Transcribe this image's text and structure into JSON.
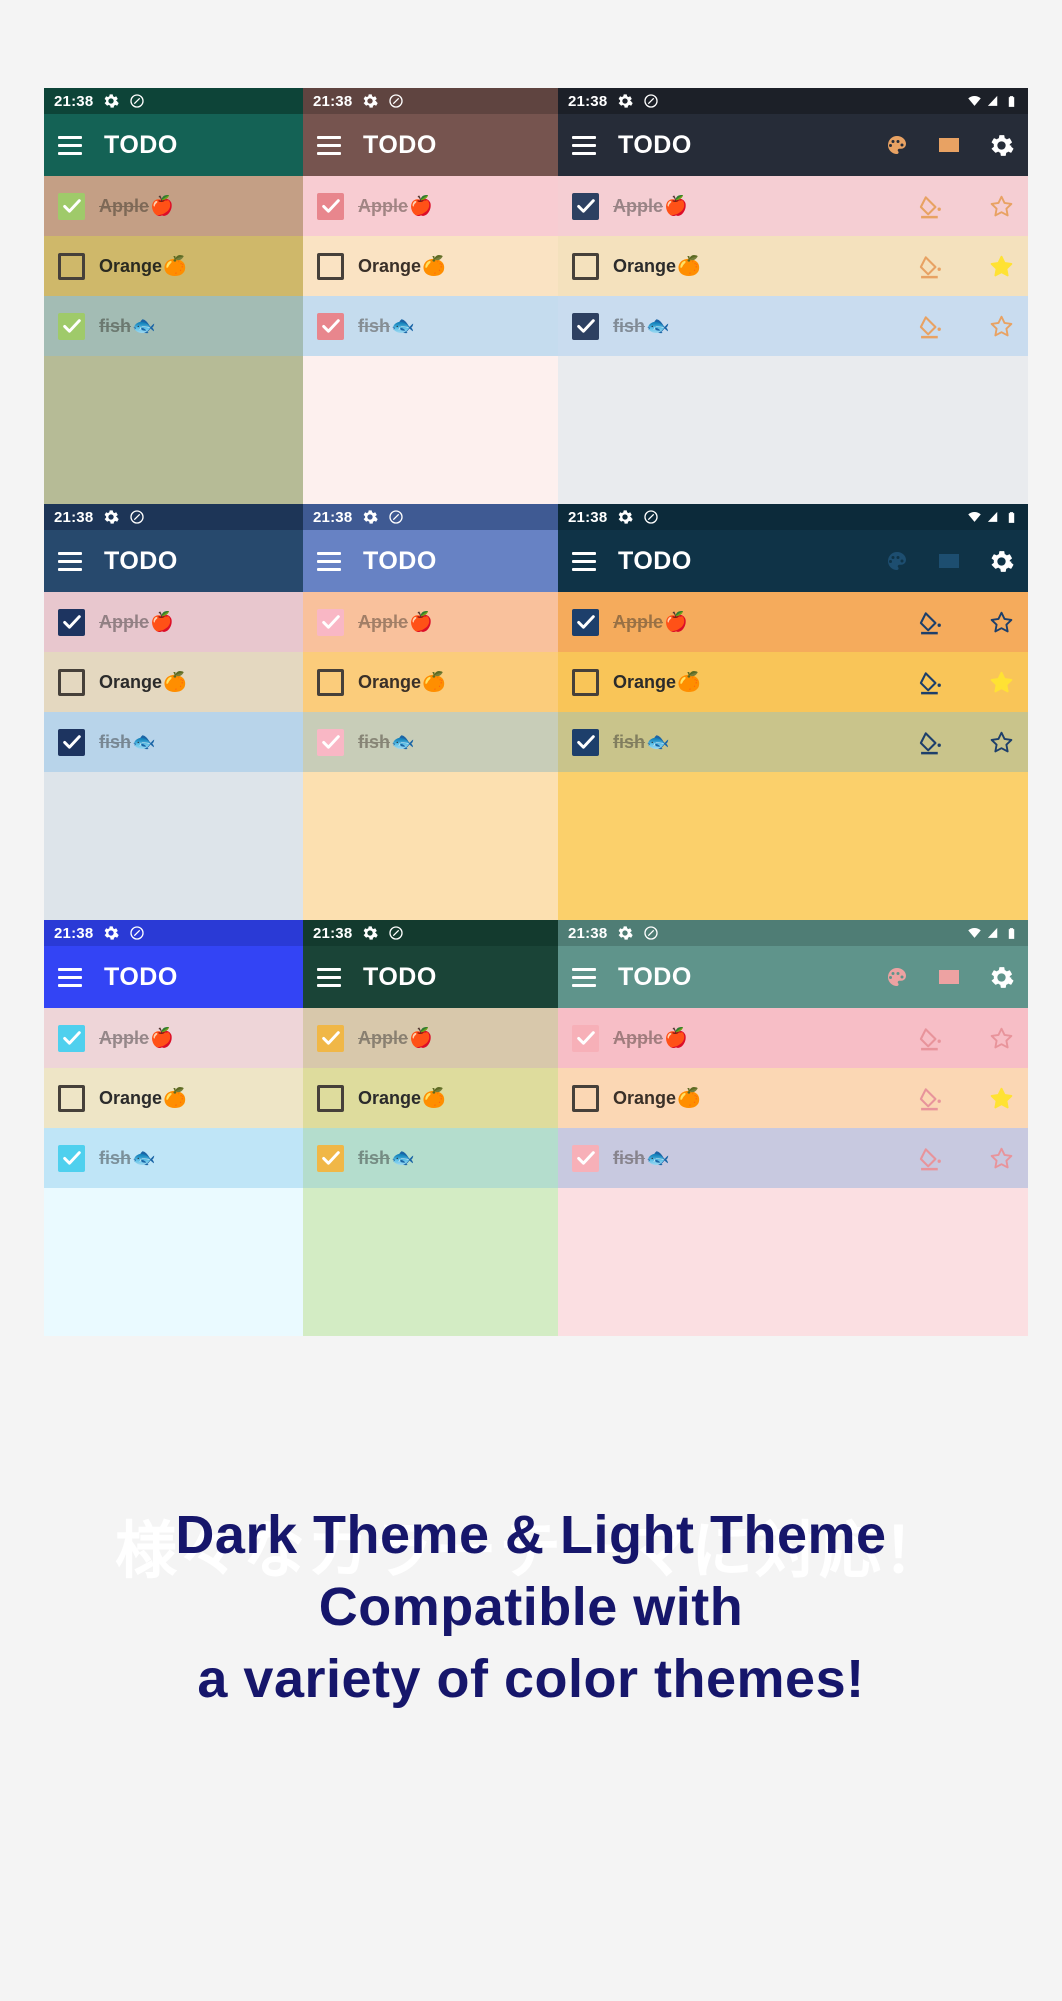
{
  "caption": {
    "jp_line": "様々なカラーテーマに対応！",
    "en_line1": "Dark Theme & Light Theme",
    "en_line2": "Compatible with",
    "en_line3": "a variety of color themes!",
    "en_color": "#16166b",
    "jp_color": "#ffffff"
  },
  "status_bar": {
    "time": "21:38",
    "icons": [
      "gear-icon",
      "do-not-disturb-icon"
    ],
    "right_icons": [
      "wifi-icon",
      "cell-signal-icon",
      "battery-icon"
    ]
  },
  "app": {
    "title": "TODO",
    "menu_icon": "hamburger-icon",
    "actions": [
      "palette-icon",
      "keyboard-icon",
      "settings-gear-icon"
    ],
    "row_actions": [
      "paint-bucket-icon",
      "star-icon"
    ]
  },
  "todos": [
    {
      "label": "Apple",
      "emoji": "🍎",
      "checked": true
    },
    {
      "label": "Orange",
      "emoji": "🍊",
      "checked": false
    },
    {
      "label": "fish",
      "emoji": "🐟",
      "checked": true
    }
  ],
  "themes": [
    {
      "id": "teal-dark",
      "name": "Dark Teal",
      "show_actions": false,
      "show_signal": false,
      "statusbar_bg": "#0d4438",
      "appbar_bg": "#146255",
      "appbar_fg": "#ffffff",
      "action_fg": "#ffffff",
      "body_bg": "#b6bb96",
      "row_bg": [
        "#c49f85",
        "#cfb86a",
        "#a3bcb4"
      ],
      "check_bg": "#9fca6a",
      "check_fg": "#ffffff",
      "text_fg": "#2a2a20",
      "row_action_fg": "#d98f4e"
    },
    {
      "id": "mauve",
      "name": "Mauve Brown",
      "show_actions": false,
      "show_signal": false,
      "statusbar_bg": "#5f4440",
      "appbar_bg": "#76544f",
      "appbar_fg": "#ffffff",
      "action_fg": "#ffffff",
      "body_bg": "#fdf0ee",
      "row_bg": [
        "#f8ccd2",
        "#fae3c3",
        "#c5dcee"
      ],
      "check_bg": "#e8868d",
      "check_fg": "#ffffff",
      "text_fg": "#3a3028",
      "row_action_fg": "#e8868d"
    },
    {
      "id": "charcoal",
      "name": "Charcoal Dark",
      "show_actions": true,
      "show_signal": true,
      "statusbar_bg": "#1c2028",
      "appbar_bg": "#262c38",
      "appbar_fg": "#ffffff",
      "action_fg": "#e8a263",
      "body_bg": "#e9ebee",
      "row_bg": [
        "#f5ced3",
        "#f4e1bd",
        "#c9dcef"
      ],
      "check_bg": "#2d4061",
      "check_fg": "#ffffff",
      "text_fg": "#2b2b2b",
      "row_action_fg": "#e8a263",
      "star_on_color": "#ffe233"
    },
    {
      "id": "navy",
      "name": "Navy Blue",
      "show_actions": false,
      "show_signal": false,
      "statusbar_bg": "#1d3557",
      "appbar_bg": "#27496d",
      "appbar_fg": "#ffffff",
      "action_fg": "#ffffff",
      "body_bg": "#dde4ea",
      "row_bg": [
        "#e8c7ce",
        "#e4d8c0",
        "#b8d4ea"
      ],
      "check_bg": "#1d3460",
      "check_fg": "#ffffff",
      "text_fg": "#2b2b2b",
      "row_action_fg": "#1d3460"
    },
    {
      "id": "periwinkle",
      "name": "Periwinkle",
      "show_actions": false,
      "show_signal": false,
      "statusbar_bg": "#3f5a93",
      "appbar_bg": "#6782c4",
      "appbar_fg": "#ffffff",
      "action_fg": "#ffffff",
      "body_bg": "#fce0b0",
      "row_bg": [
        "#f9c19c",
        "#fbcc7b",
        "#c8cdb8"
      ],
      "check_bg": "#f9b7c5",
      "check_fg": "#ffffff",
      "text_fg": "#3a3028",
      "row_action_fg": "#f9b7c5"
    },
    {
      "id": "amber-dark",
      "name": "Amber on Dark Teal",
      "show_actions": true,
      "show_signal": true,
      "statusbar_bg": "#0c2a3a",
      "appbar_bg": "#0f3347",
      "appbar_fg": "#ffffff",
      "action_fg": "#1d4e70",
      "body_bg": "#fbd06b",
      "row_bg": [
        "#f5ab5c",
        "#f9c558",
        "#c9c48b"
      ],
      "check_bg": "#1d3f6b",
      "check_fg": "#ffffff",
      "text_fg": "#2b2b2b",
      "row_action_fg": "#1d3f6b",
      "star_on_color": "#ffe233"
    },
    {
      "id": "royal-blue",
      "name": "Royal Blue",
      "show_actions": false,
      "show_signal": false,
      "statusbar_bg": "#2a3ad6",
      "appbar_bg": "#3344f5",
      "appbar_fg": "#ffffff",
      "action_fg": "#ffffff",
      "body_bg": "#eafaff",
      "row_bg": [
        "#eed5d8",
        "#eee5c6",
        "#bfe5f7"
      ],
      "check_bg": "#4fd0ee",
      "check_fg": "#ffffff",
      "text_fg": "#2b2b2b",
      "row_action_fg": "#4fd0ee"
    },
    {
      "id": "forest",
      "name": "Forest Green",
      "show_actions": false,
      "show_signal": false,
      "statusbar_bg": "#133a2e",
      "appbar_bg": "#1a4437",
      "appbar_fg": "#ffffff",
      "action_fg": "#ffffff",
      "body_bg": "#d3ecc4",
      "row_bg": [
        "#d8c8ab",
        "#dedc9d",
        "#b4ddcd"
      ],
      "check_bg": "#f0b747",
      "check_fg": "#ffffff",
      "text_fg": "#2b2b2b",
      "row_action_fg": "#f0b747"
    },
    {
      "id": "sage-pink",
      "name": "Sage & Pink",
      "show_actions": true,
      "show_signal": true,
      "statusbar_bg": "#4f7d75",
      "appbar_bg": "#5f948b",
      "appbar_fg": "#ffffff",
      "action_fg": "#eda2a2",
      "body_bg": "#fbdfe2",
      "row_bg": [
        "#f7bec6",
        "#fbd7b4",
        "#c8c9e0"
      ],
      "check_bg": "#f7b0b8",
      "check_fg": "#ffffff",
      "text_fg": "#3a3028",
      "row_action_fg": "#e8949b",
      "star_on_color": "#ffe233"
    }
  ]
}
